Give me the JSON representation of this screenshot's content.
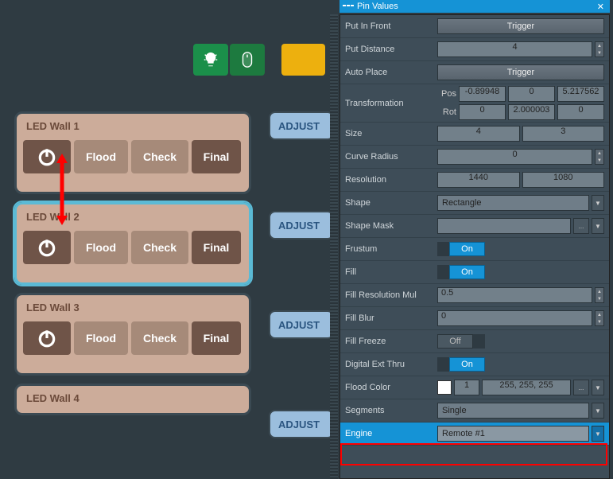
{
  "panel": {
    "title": "Pin Values",
    "rows": {
      "put_in_front": {
        "label": "Put In Front",
        "btn": "Trigger"
      },
      "put_distance": {
        "label": "Put Distance",
        "v": "4"
      },
      "auto_place": {
        "label": "Auto Place",
        "btn": "Trigger"
      },
      "transformation": {
        "label": "Transformation",
        "pos_label": "Pos",
        "rot_label": "Rot",
        "pos": [
          "-0.89948",
          "0",
          "5.217562"
        ],
        "rot": [
          "0",
          "2.000003",
          "0"
        ]
      },
      "size": {
        "label": "Size",
        "a": "4",
        "b": "3"
      },
      "curve_radius": {
        "label": "Curve Radius",
        "v": "0"
      },
      "resolution": {
        "label": "Resolution",
        "a": "1440",
        "b": "1080"
      },
      "shape": {
        "label": "Shape",
        "v": "Rectangle"
      },
      "shape_mask": {
        "label": "Shape Mask",
        "v": ""
      },
      "frustum": {
        "label": "Frustum",
        "v": "On"
      },
      "fill": {
        "label": "Fill",
        "v": "On"
      },
      "fill_res_mul": {
        "label": "Fill Resolution Mul",
        "v": "0.5"
      },
      "fill_blur": {
        "label": "Fill Blur",
        "v": "0"
      },
      "fill_freeze": {
        "label": "Fill Freeze",
        "v": "Off"
      },
      "digital_ext_thru": {
        "label": "Digital Ext Thru",
        "v": "On"
      },
      "flood_color": {
        "label": "Flood Color",
        "a": "1",
        "b": "255, 255, 255"
      },
      "segments": {
        "label": "Segments",
        "v": "Single"
      },
      "engine": {
        "label": "Engine",
        "v": "Remote #1"
      }
    }
  },
  "walls": [
    {
      "title": "LED Wall 1"
    },
    {
      "title": "LED Wall 2"
    },
    {
      "title": "LED Wall 3"
    },
    {
      "title": "LED Wall 4"
    }
  ],
  "wall_btns": {
    "flood": "Flood",
    "check": "Check",
    "final": "Final"
  },
  "adjust_label": "ADJUST",
  "ellipsis": "..."
}
